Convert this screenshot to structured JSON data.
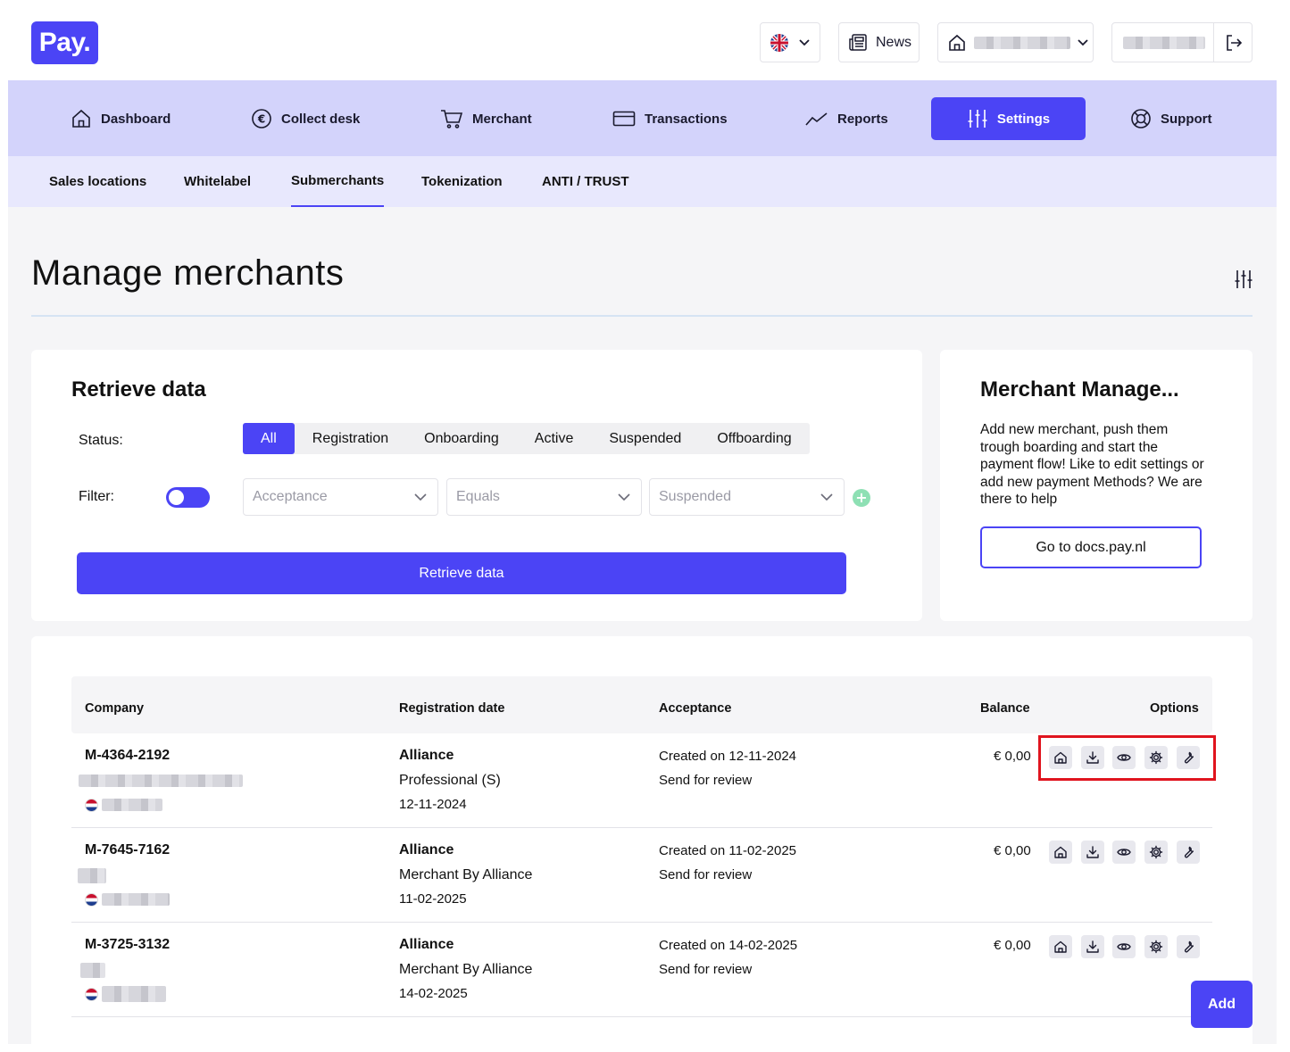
{
  "header": {
    "logo_text": "Pay.",
    "news_label": "News"
  },
  "nav": {
    "items": [
      {
        "label": "Dashboard",
        "icon": "home-icon"
      },
      {
        "label": "Collect desk",
        "icon": "euro-icon"
      },
      {
        "label": "Merchant",
        "icon": "cart-icon"
      },
      {
        "label": "Transactions",
        "icon": "card-icon"
      },
      {
        "label": "Reports",
        "icon": "chart-line-icon"
      },
      {
        "label": "Settings",
        "icon": "sliders-icon",
        "active": true
      },
      {
        "label": "Support",
        "icon": "lifebuoy-icon"
      }
    ]
  },
  "subnav": {
    "items": [
      "Sales locations",
      "Whitelabel",
      "Submerchants",
      "Tokenization",
      "ANTI / TRUST"
    ],
    "active": "Submerchants"
  },
  "page": {
    "title": "Manage merchants"
  },
  "retrieve": {
    "title": "Retrieve data",
    "status_label": "Status:",
    "statuses": [
      "All",
      "Registration",
      "Onboarding",
      "Active",
      "Suspended",
      "Offboarding"
    ],
    "active_status": "All",
    "filter_label": "Filter:",
    "filter_field": "Acceptance",
    "filter_operator": "Equals",
    "filter_value": "Suspended",
    "button_label": "Retrieve data"
  },
  "side": {
    "title": "Merchant Manage...",
    "text": "Add new merchant, push them trough boarding and start the payment flow! Like to edit settings or add new payment Methods? We are there to help",
    "button_label": "Go to docs.pay.nl"
  },
  "table": {
    "headers": {
      "company": "Company",
      "registration": "Registration date",
      "acceptance": "Acceptance",
      "balance": "Balance",
      "options": "Options"
    },
    "rows": [
      {
        "id": "M-4364-2192",
        "partner": "Alliance",
        "package": "Professional (S)",
        "date": "12-11-2024",
        "created": "Created on 12-11-2024",
        "status": "Send for review",
        "balance": "€ 0,00"
      },
      {
        "id": "M-7645-7162",
        "partner": "Alliance",
        "package": "Merchant By Alliance",
        "date": "11-02-2025",
        "created": "Created on 11-02-2025",
        "status": "Send for review",
        "balance": "€ 0,00"
      },
      {
        "id": "M-3725-3132",
        "partner": "Alliance",
        "package": "Merchant By Alliance",
        "date": "14-02-2025",
        "created": "Created on 14-02-2025",
        "status": "Send for review",
        "balance": "€ 0,00"
      }
    ]
  },
  "add_button_label": "Add",
  "colors": {
    "brand": "#4b44f5",
    "nav_bg": "#d3d3fb",
    "subnav_bg": "#e8e8fd",
    "highlight": "#e0141e"
  }
}
